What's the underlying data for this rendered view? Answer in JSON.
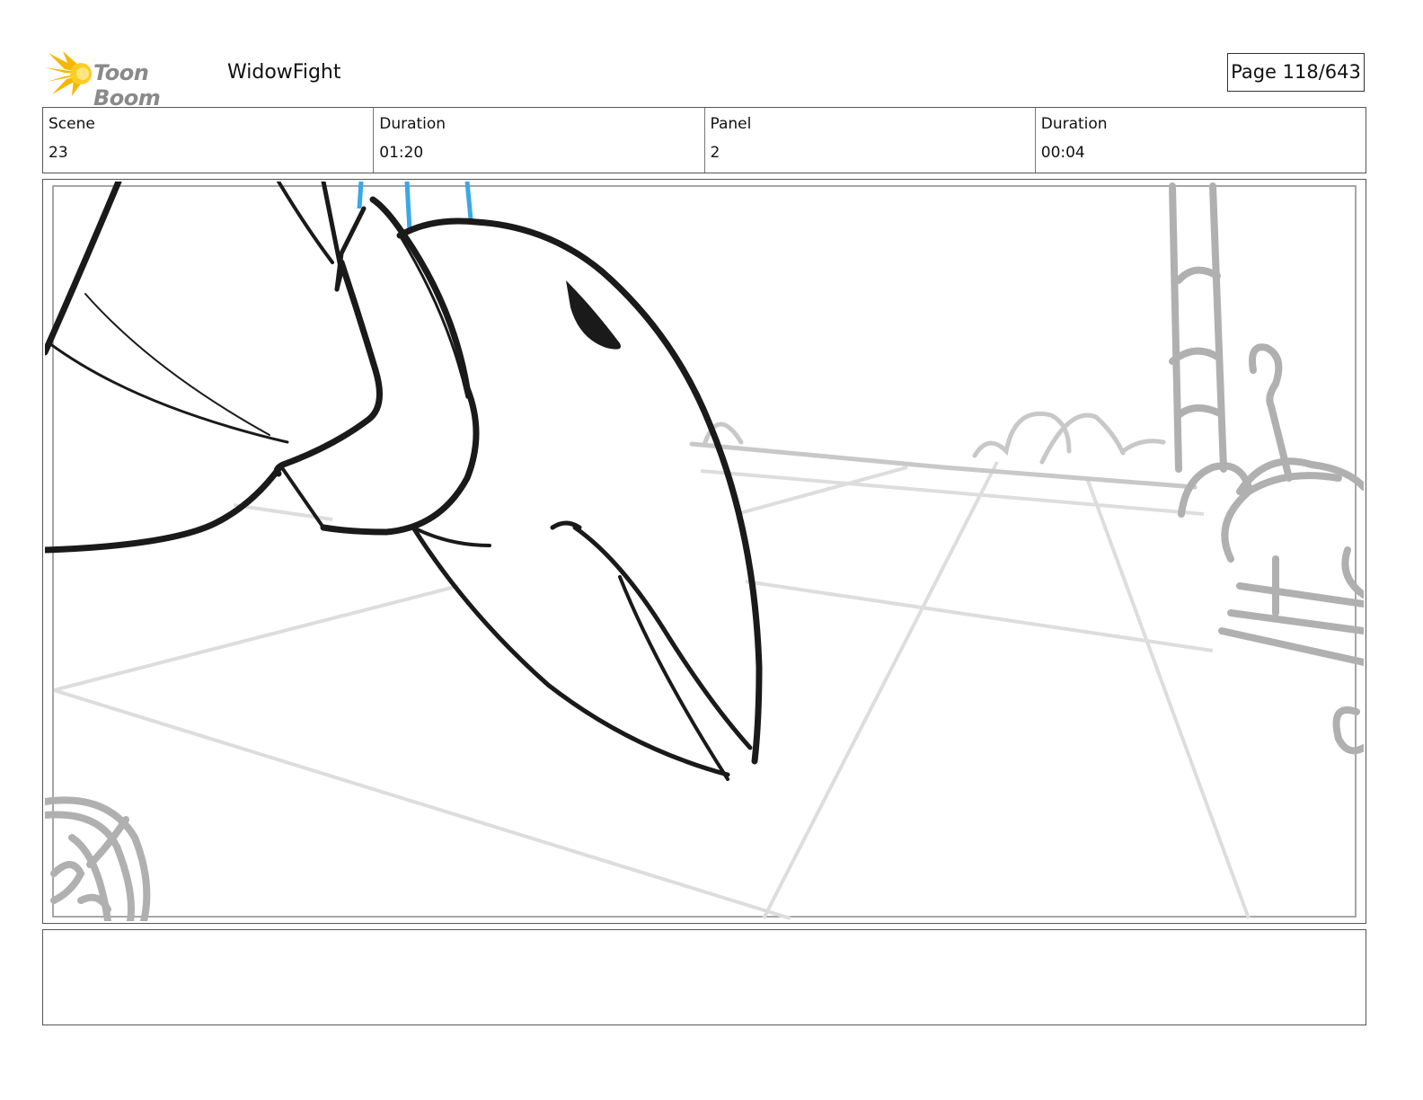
{
  "header": {
    "brand": "Toon Boom",
    "project": "WidowFight",
    "page": "Page 118/643"
  },
  "info": {
    "scene_label": "Scene",
    "scene_value": "23",
    "scene_duration_label": "Duration",
    "scene_duration_value": "01:20",
    "panel_label": "Panel",
    "panel_value": "2",
    "panel_duration_label": "Duration",
    "panel_duration_value": "00:04"
  },
  "colors": {
    "ink": "#1a1a1a",
    "background_sketch": "#c8c8c8",
    "accent_blue": "#3aa8e8",
    "logo_yellow": "#f5b800"
  },
  "notes": {
    "text": ""
  }
}
